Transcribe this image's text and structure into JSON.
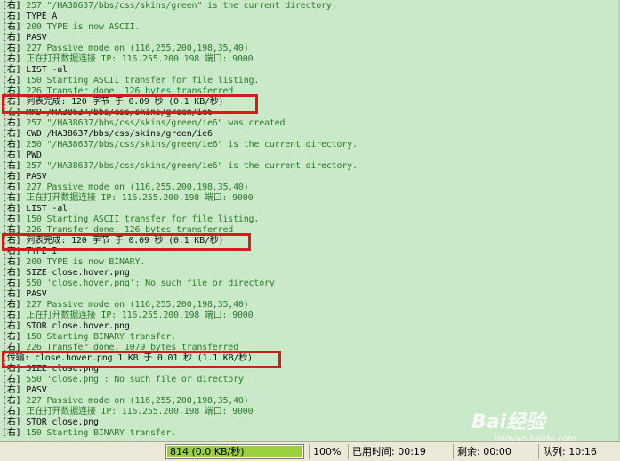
{
  "log": {
    "lines": [
      {
        "p": "[右]",
        "t": " 257 \"/HA38637/bbs/css/skins/green\" is the current directory.",
        "c": "green"
      },
      {
        "p": "[右]",
        "t": " TYPE A",
        "c": "black"
      },
      {
        "p": "[右]",
        "t": " 200 TYPE is now ASCII.",
        "c": "green"
      },
      {
        "p": "[右]",
        "t": " PASV",
        "c": "black"
      },
      {
        "p": "[右]",
        "t": " 227 Passive mode on (116,255,200,198,35,40)",
        "c": "green"
      },
      {
        "p": "[右]",
        "t": " 正在打开数据连接 IP: 116.255.200.198 端口: 9000",
        "c": "green"
      },
      {
        "p": "[右]",
        "t": " LIST -al",
        "c": "black"
      },
      {
        "p": "[右]",
        "t": " 150 Starting ASCII transfer for file listing.",
        "c": "green"
      },
      {
        "p": "[右]",
        "t": " 226 Transfer done. 126 bytes transferred",
        "c": "green"
      },
      {
        "p": "[右]",
        "t": " 列表完成: 120 字节 于 0.09 秒 (0.1 KB/秒)",
        "c": "black"
      },
      {
        "p": "[右]",
        "t": " MKD /HA38637/bbs/css/skins/green/ie6",
        "c": "black"
      },
      {
        "p": "[右]",
        "t": " 257 \"/HA38637/bbs/css/skins/green/ie6\" was created",
        "c": "green"
      },
      {
        "p": "[右]",
        "t": " CWD /HA38637/bbs/css/skins/green/ie6",
        "c": "black"
      },
      {
        "p": "[右]",
        "t": " 250 \"/HA38637/bbs/css/skins/green/ie6\" is the current directory.",
        "c": "green"
      },
      {
        "p": "[右]",
        "t": " PWD",
        "c": "black"
      },
      {
        "p": "[右]",
        "t": " 257 \"/HA38637/bbs/css/skins/green/ie6\" is the current directory.",
        "c": "green"
      },
      {
        "p": "[右]",
        "t": " PASV",
        "c": "black"
      },
      {
        "p": "[右]",
        "t": " 227 Passive mode on (116,255,200,198,35,40)",
        "c": "green"
      },
      {
        "p": "[右]",
        "t": " 正在打开数据连接 IP: 116.255.200.198 端口: 9000",
        "c": "green"
      },
      {
        "p": "[右]",
        "t": " LIST -al",
        "c": "black"
      },
      {
        "p": "[右]",
        "t": " 150 Starting ASCII transfer for file listing.",
        "c": "green"
      },
      {
        "p": "[右]",
        "t": " 226 Transfer done. 126 bytes transferred",
        "c": "green"
      },
      {
        "p": "[右]",
        "t": " 列表完成: 120 字节 于 0.09 秒 (0.1 KB/秒)",
        "c": "black"
      },
      {
        "p": "[右]",
        "t": " TYPE I",
        "c": "black"
      },
      {
        "p": "[右]",
        "t": " 200 TYPE is now BINARY.",
        "c": "green"
      },
      {
        "p": "[右]",
        "t": " SIZE close.hover.png",
        "c": "black"
      },
      {
        "p": "[右]",
        "t": " 550 'close.hover.png': No such file or directory",
        "c": "green"
      },
      {
        "p": "[右]",
        "t": " PASV",
        "c": "black"
      },
      {
        "p": "[右]",
        "t": " 227 Passive mode on (116,255,200,198,35,40)",
        "c": "green"
      },
      {
        "p": "[右]",
        "t": " 正在打开数据连接 IP: 116.255.200.198 端口: 9000",
        "c": "green"
      },
      {
        "p": "[右]",
        "t": " STOR close.hover.png",
        "c": "black"
      },
      {
        "p": "[右]",
        "t": " 150 Starting BINARY transfer.",
        "c": "green"
      },
      {
        "p": "[右]",
        "t": " 226 Transfer done. 1079 bytes transferred",
        "c": "green"
      },
      {
        "p": "[",
        "t": "传输: close.hover.png 1 KB 于 0.01 秒 (1.1 KB/秒)",
        "c": "black"
      },
      {
        "p": "[右]",
        "t": " SIZE close.png",
        "c": "black"
      },
      {
        "p": "[右]",
        "t": " 550 'close.png': No such file or directory",
        "c": "green"
      },
      {
        "p": "[右]",
        "t": " PASV",
        "c": "black"
      },
      {
        "p": "[右]",
        "t": " 227 Passive mode on (116,255,200,198,35,40)",
        "c": "green"
      },
      {
        "p": "[右]",
        "t": " 正在打开数据连接 IP: 116.255.200.198 端口: 9000",
        "c": "green"
      },
      {
        "p": "[右]",
        "t": " STOR close.png",
        "c": "black"
      },
      {
        "p": "[右]",
        "t": " 150 Starting BINARY transfer.",
        "c": "green"
      }
    ]
  },
  "status": {
    "progress_text": "814 (0.0 KB/秒)",
    "progress_value": 1.0,
    "percent": "100%",
    "elapsed": "已用时间: 00:19",
    "remaining": "剩余: 00:00",
    "queue": "队列: 10:16"
  },
  "colors": {
    "log_bg": "#c9e9c8",
    "response_text": "#2c7a2c",
    "command_text": "#111111",
    "highlight_border": "#d41c1c",
    "progress_fill": "#9ccf3e"
  },
  "watermark": {
    "logo": "Bai经验",
    "sub": "jingyan.baidu.com"
  }
}
